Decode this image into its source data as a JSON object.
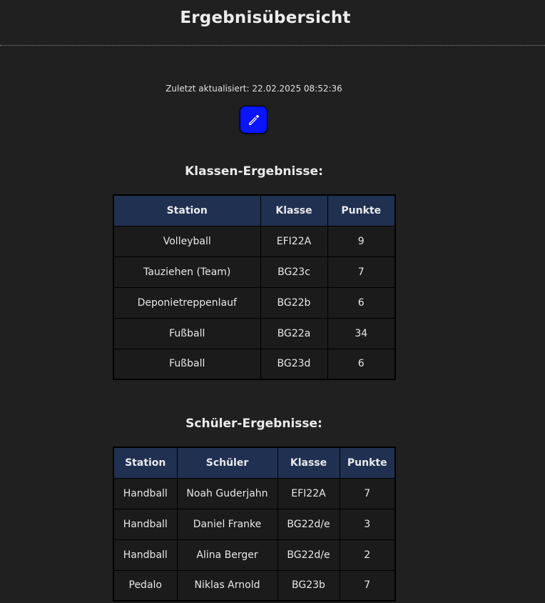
{
  "header": {
    "title": "Ergebnisübersicht"
  },
  "status": {
    "last_updated": "Zuletzt aktualisiert: 22.02.2025 08:52:36"
  },
  "edit_button": {
    "icon": "pencil-icon"
  },
  "class_results": {
    "heading": "Klassen-Ergebnisse:",
    "columns": [
      "Station",
      "Klasse",
      "Punkte"
    ],
    "rows": [
      [
        "Volleyball",
        "EFI22A",
        "9"
      ],
      [
        "Tauziehen (Team)",
        "BG23c",
        "7"
      ],
      [
        "Deponietreppenlauf",
        "BG22b",
        "6"
      ],
      [
        "Fußball",
        "BG22a",
        "34"
      ],
      [
        "Fußball",
        "BG23d",
        "6"
      ]
    ]
  },
  "student_results": {
    "heading": "Schüler-Ergebnisse:",
    "columns": [
      "Station",
      "Schüler",
      "Klasse",
      "Punkte"
    ],
    "rows": [
      [
        "Handball",
        "Noah Guderjahn",
        "EFI22A",
        "7"
      ],
      [
        "Handball",
        "Daniel Franke",
        "BG22d/e",
        "3"
      ],
      [
        "Handball",
        "Alina Berger",
        "BG22d/e",
        "2"
      ],
      [
        "Pedalo",
        "Niklas Arnold",
        "BG23b",
        "7"
      ]
    ]
  },
  "colors": {
    "background": "#202020",
    "table_header": "#203050",
    "edit_button": "#0a14ff"
  }
}
